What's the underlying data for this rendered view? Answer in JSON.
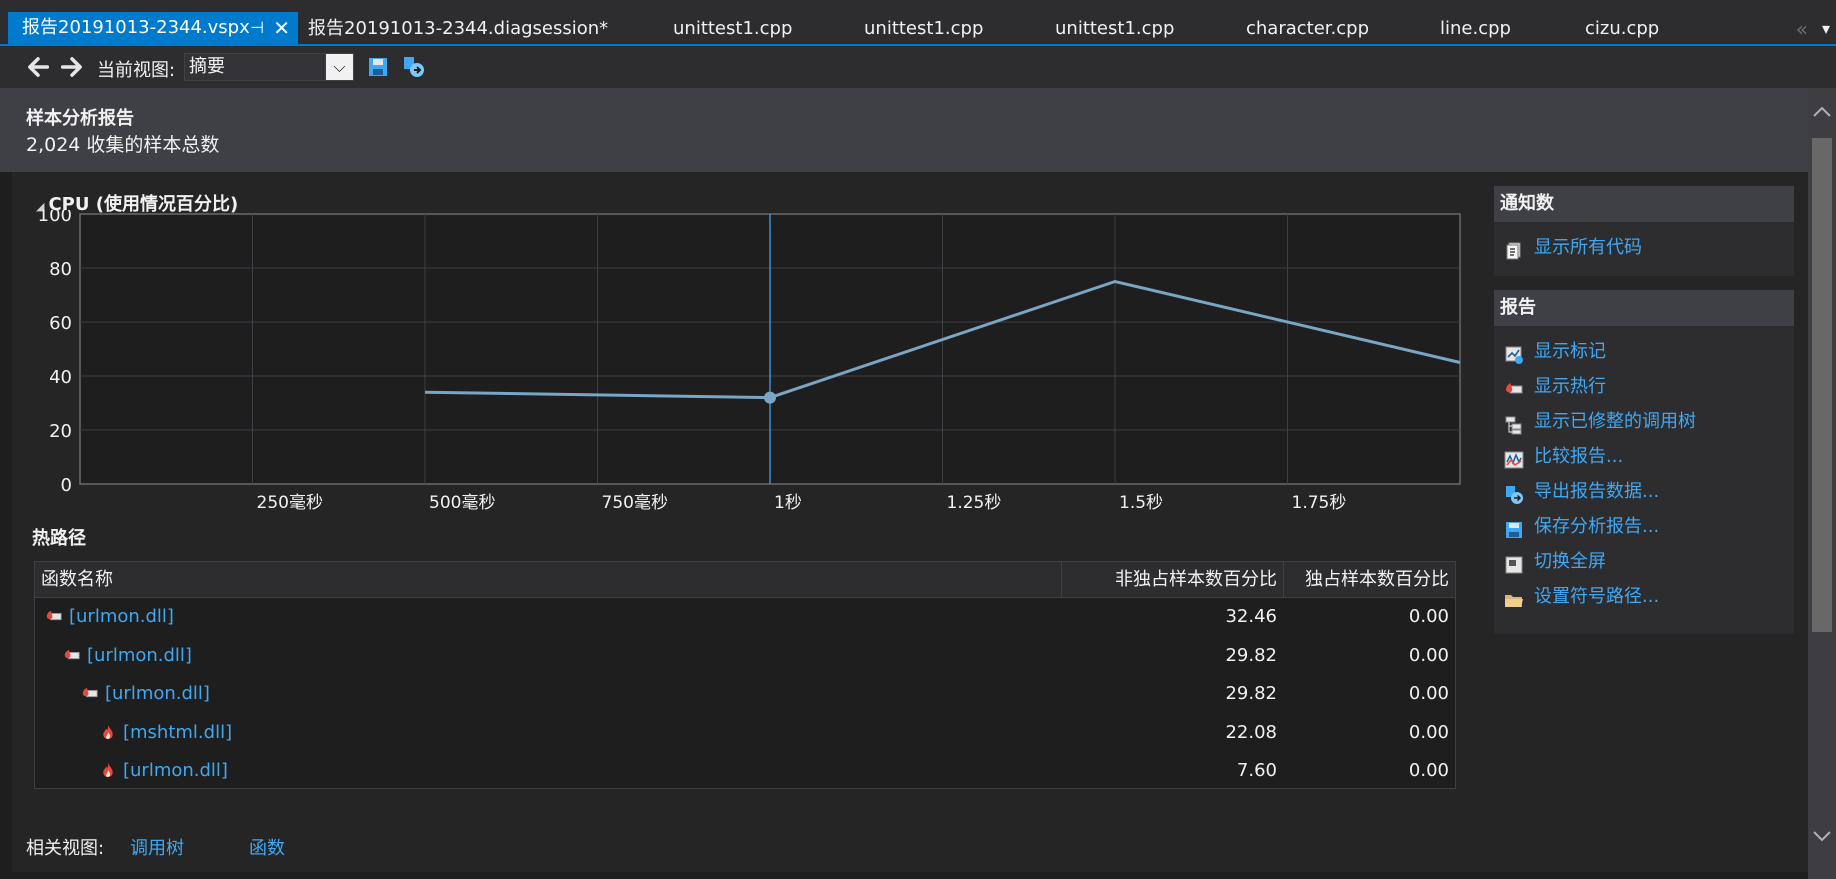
{
  "tabs": [
    {
      "label": "报告20191013-2344.vspx",
      "active": true
    },
    {
      "label": "报告20191013-2344.diagsession*"
    },
    {
      "label": "unittest1.cpp"
    },
    {
      "label": "unittest1.cpp"
    },
    {
      "label": "unittest1.cpp"
    },
    {
      "label": "character.cpp"
    },
    {
      "label": "line.cpp"
    },
    {
      "label": "cizu.cpp"
    }
  ],
  "tab_pin_glyph": "⊣",
  "tab_close_glyph": "✕",
  "tab_overflow_glyph": "«",
  "tab_dropdown_glyph": "▾",
  "toolbar": {
    "back_glyph": "🡐",
    "forward_glyph": "🡒",
    "current_view_label": "当前视图:",
    "current_view_value": "摘要",
    "dropdown_glyph": "⌵"
  },
  "header": {
    "title": "样本分析报告",
    "sample_count": "2,024 收集的样本总数"
  },
  "colors": {
    "accent": "#007acc",
    "link": "#3fa8f4",
    "chart_line": "#79a6c4",
    "hot_icon": "#e8483c"
  },
  "chart_data": {
    "type": "line",
    "title": "CPU (使用情况百分比)",
    "title_toggle_glyph": "◢",
    "xlim": [
      0,
      2.0
    ],
    "ylim": [
      0,
      100
    ],
    "y_ticks": [
      0,
      20,
      40,
      60,
      80,
      100
    ],
    "x_ticks": [
      {
        "value": 0.25,
        "label": "250毫秒"
      },
      {
        "value": 0.5,
        "label": "500毫秒"
      },
      {
        "value": 0.75,
        "label": "750毫秒"
      },
      {
        "value": 1.0,
        "label": "1秒"
      },
      {
        "value": 1.25,
        "label": "1.25秒"
      },
      {
        "value": 1.5,
        "label": "1.5秒"
      },
      {
        "value": 1.75,
        "label": "1.75秒"
      }
    ],
    "series": [
      {
        "x": [
          0.5,
          1.0,
          1.5,
          2.0
        ],
        "y": [
          34,
          32,
          75,
          45
        ]
      }
    ],
    "selection": {
      "x": 1.0,
      "y": 32
    },
    "grid": true
  },
  "hot_path": {
    "title": "热路径",
    "columns": [
      "函数名称",
      "非独占样本数百分比",
      "独占样本数百分比"
    ],
    "rows": [
      {
        "name": "[urlmon.dll]",
        "inclusive": "32.46",
        "exclusive": "0.00",
        "level": 0,
        "icon": "hot-path-icon"
      },
      {
        "name": "[urlmon.dll]",
        "inclusive": "29.82",
        "exclusive": "0.00",
        "level": 1,
        "icon": "hot-path-icon"
      },
      {
        "name": "[urlmon.dll]",
        "inclusive": "29.82",
        "exclusive": "0.00",
        "level": 2,
        "icon": "hot-path-icon"
      },
      {
        "name": "[mshtml.dll]",
        "inclusive": "22.08",
        "exclusive": "0.00",
        "level": 3,
        "icon": "flame-icon"
      },
      {
        "name": "[urlmon.dll]",
        "inclusive": "7.60",
        "exclusive": "0.00",
        "level": 3,
        "icon": "flame-icon"
      }
    ]
  },
  "notifications": {
    "title": "通知数",
    "links": [
      {
        "label": "显示所有代码",
        "icon": "code-document-icon"
      }
    ]
  },
  "reports": {
    "title": "报告",
    "links": [
      {
        "label": "显示标记",
        "icon": "marks-icon"
      },
      {
        "label": "显示热行",
        "icon": "hot-lines-icon"
      },
      {
        "label": "显示已修整的调用树",
        "icon": "call-tree-icon"
      },
      {
        "label": "比较报告...",
        "icon": "compare-icon"
      },
      {
        "label": "导出报告数据...",
        "icon": "export-icon"
      },
      {
        "label": "保存分析报告...",
        "icon": "save-icon"
      },
      {
        "label": "切换全屏",
        "icon": "fullscreen-icon"
      },
      {
        "label": "设置符号路径...",
        "icon": "folder-icon"
      }
    ]
  },
  "related": {
    "label": "相关视图:",
    "links": [
      "调用树",
      "函数"
    ]
  }
}
